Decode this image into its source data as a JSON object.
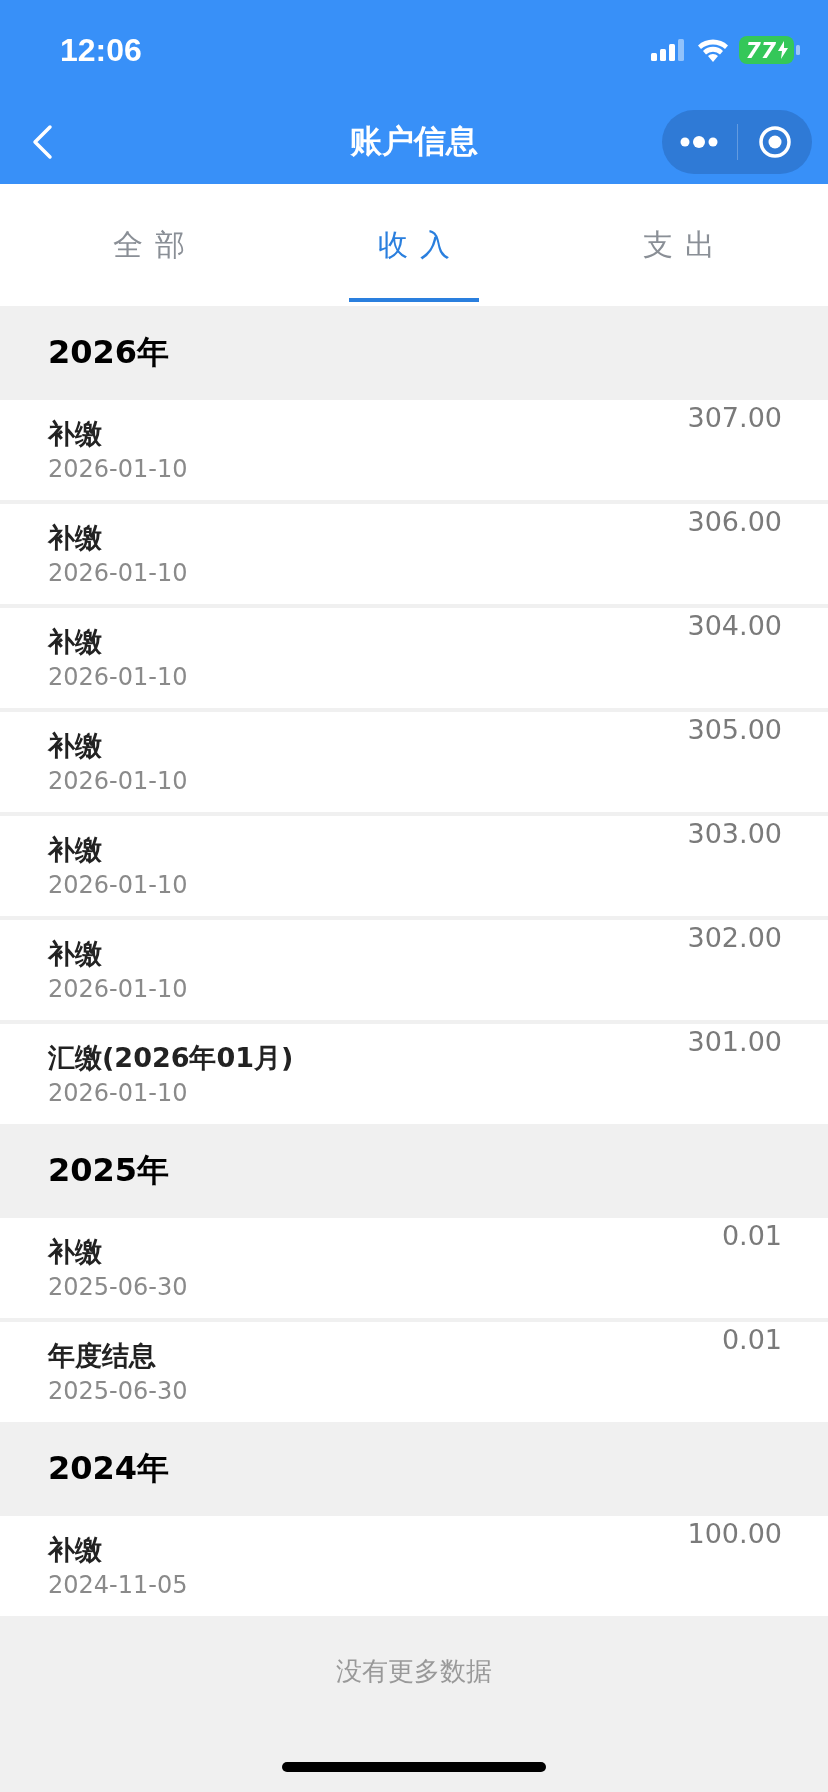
{
  "status_bar": {
    "time": "12:06",
    "battery": "77"
  },
  "nav": {
    "title": "账户信息"
  },
  "tabs": [
    {
      "label": "全部",
      "selected": false
    },
    {
      "label": "收入",
      "selected": true
    },
    {
      "label": "支出",
      "selected": false
    }
  ],
  "groups": [
    {
      "year": "2026年",
      "records": [
        {
          "title": "补缴",
          "date": "2026-01-10",
          "amount": "307.00"
        },
        {
          "title": "补缴",
          "date": "2026-01-10",
          "amount": "306.00"
        },
        {
          "title": "补缴",
          "date": "2026-01-10",
          "amount": "304.00"
        },
        {
          "title": "补缴",
          "date": "2026-01-10",
          "amount": "305.00"
        },
        {
          "title": "补缴",
          "date": "2026-01-10",
          "amount": "303.00"
        },
        {
          "title": "补缴",
          "date": "2026-01-10",
          "amount": "302.00"
        },
        {
          "title": "汇缴(2026年01月)",
          "date": "2026-01-10",
          "amount": "301.00"
        }
      ]
    },
    {
      "year": "2025年",
      "records": [
        {
          "title": "补缴",
          "date": "2025-06-30",
          "amount": "0.01"
        },
        {
          "title": "年度结息",
          "date": "2025-06-30",
          "amount": "0.01"
        }
      ]
    },
    {
      "year": "2024年",
      "records": [
        {
          "title": "补缴",
          "date": "2024-11-05",
          "amount": "100.00"
        }
      ]
    }
  ],
  "footer": "没有更多数据"
}
